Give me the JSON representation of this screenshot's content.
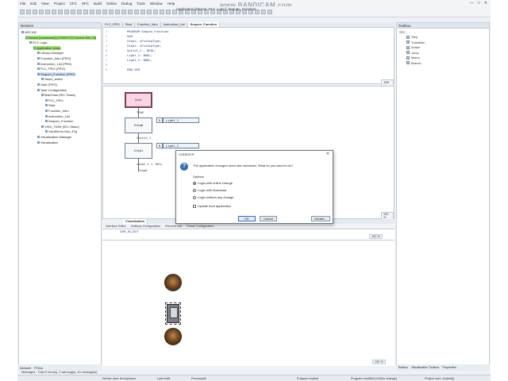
{
  "window": {
    "title": "Application [Device: PLC Logic]: Sequen_Function",
    "watermark": "www.BANDICAM.com",
    "controls": [
      "—",
      "□",
      "✕"
    ]
  },
  "menubar": [
    "File",
    "Edit",
    "View",
    "Project",
    "CFC",
    "SFC",
    "Build",
    "Online",
    "Debug",
    "Tools",
    "Window",
    "Help"
  ],
  "devices": {
    "title": "Devices",
    "tree": [
      {
        "label": "ARC342",
        "level": 0,
        "hl": ""
      },
      {
        "label": "Device [connected] (CODESYS Control Win V3)",
        "level": 1,
        "hl": "hl-green"
      },
      {
        "label": "PLC Logic",
        "level": 2,
        "hl": ""
      },
      {
        "label": "Application [stop]",
        "level": 3,
        "hl": "hl-green"
      },
      {
        "label": "Library Manager",
        "level": 4,
        "hl": ""
      },
      {
        "label": "Function_Intro (PRG)",
        "level": 4,
        "hl": ""
      },
      {
        "label": "Instruction_List (PRG)",
        "level": 4,
        "hl": ""
      },
      {
        "label": "PLC_PRG (PRG)",
        "level": 4,
        "hl": ""
      },
      {
        "label": "Sequen_Function (PRG)",
        "level": 4,
        "hl": "hl-blue"
      },
      {
        "label": "Step0_active",
        "level": 5,
        "hl": ""
      },
      {
        "label": "Start (PRG)",
        "level": 4,
        "hl": ""
      },
      {
        "label": "Task Configuration",
        "level": 4,
        "hl": ""
      },
      {
        "label": "MainTask (IEC-Tasks)",
        "level": 5,
        "hl": ""
      },
      {
        "label": "PLC_PRG",
        "level": 6,
        "hl": ""
      },
      {
        "label": "Start",
        "level": 6,
        "hl": ""
      },
      {
        "label": "Function_Intro",
        "level": 6,
        "hl": ""
      },
      {
        "label": "Instruction_List",
        "level": 6,
        "hl": ""
      },
      {
        "label": "Sequen_Function",
        "level": 6,
        "hl": ""
      },
      {
        "label": "VISU_TASK (IEC-Tasks)",
        "level": 5,
        "hl": ""
      },
      {
        "label": "VisuElems.Visu_Prg",
        "level": 6,
        "hl": ""
      },
      {
        "label": "Visualization Manager",
        "level": 4,
        "hl": ""
      },
      {
        "label": "Visualization",
        "level": 4,
        "hl": ""
      }
    ],
    "bottom_tabs": [
      "Devices",
      "POUs"
    ]
  },
  "editor": {
    "tabs": [
      "PLC_PRG",
      "Start",
      "Function_Intro",
      "Instruction_List",
      "Sequen_Function"
    ],
    "active_tab": "Sequen_Function",
    "declaration": [
      "PROGRAM Sequen_Function",
      "VAR",
      "    Step1: sFcstepType;",
      "    Step1: sFcstepType;",
      "    Switch_1 : BOOL;",
      "    Light_1: BOOL;",
      "    Light_2: BOOL;",
      "",
      "END_VAR"
    ],
    "decl_zoom": "100 %",
    "sfc_zoom": "100 %"
  },
  "sfc": {
    "init_step": "Init",
    "step0": "Step0",
    "step1": "Step1",
    "trans_true": "TRUE",
    "trans_switch": "Switch_1",
    "trans_time": "step1.t > T#2s",
    "jump_target": "Step0",
    "action_q": "N",
    "action_light1": "Light_1",
    "action_light2": "Light_2"
  },
  "visualization": {
    "tabs": [
      "Visualization"
    ],
    "subtabs": [
      "Interface Editor",
      "Hotkeys Configuration",
      "Element List",
      "Frame Configuration"
    ],
    "decl": "VAR_IN_OUT",
    "zoom": "100 %",
    "zoom2": "100 %"
  },
  "toolbox": {
    "title": "Toolbox",
    "section": "SFC",
    "items": [
      "Step",
      "Transition",
      "Action",
      "Jump",
      "Macro",
      "Branch"
    ],
    "bottom_tabs": [
      "Toolbox",
      "Visualization Toolbox",
      "Properties"
    ]
  },
  "messages": "Messages - Total 0 error(s), 0 warning(s), 40 message(s)",
  "status": {
    "device_user": "Device user: Anonymous",
    "last_build": "Last build:",
    "precompile": "Precompile",
    "project_user": "Project user: (nobody)",
    "program_loaded": "Program loaded",
    "program_modified": "Program modified (Online change)"
  },
  "dialog": {
    "title": "CODESYS",
    "message": "The application changed since last download. What do you want to do?",
    "options_label": "Options",
    "radio_options": [
      "Login with online change",
      "Login with download",
      "Login without any change"
    ],
    "checkbox": "Update boot application",
    "ok": "OK",
    "cancel": "Cancel",
    "details": "Details..."
  }
}
